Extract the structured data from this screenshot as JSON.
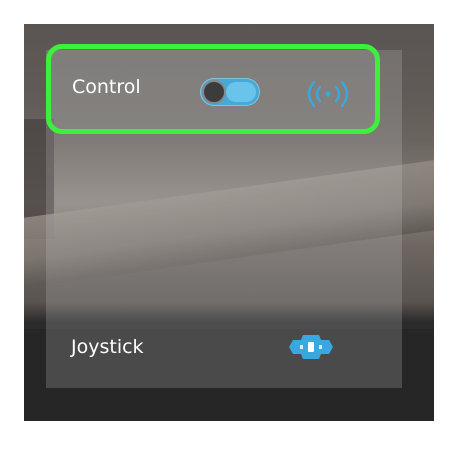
{
  "control": {
    "label": "Control",
    "toggle_on": true,
    "status_icon": "broadcast-icon"
  },
  "joystick": {
    "label": "Joystick",
    "icon": "gamepad-icon"
  },
  "colors": {
    "highlight": "#3cf13c",
    "accent": "#3aa8e0"
  }
}
